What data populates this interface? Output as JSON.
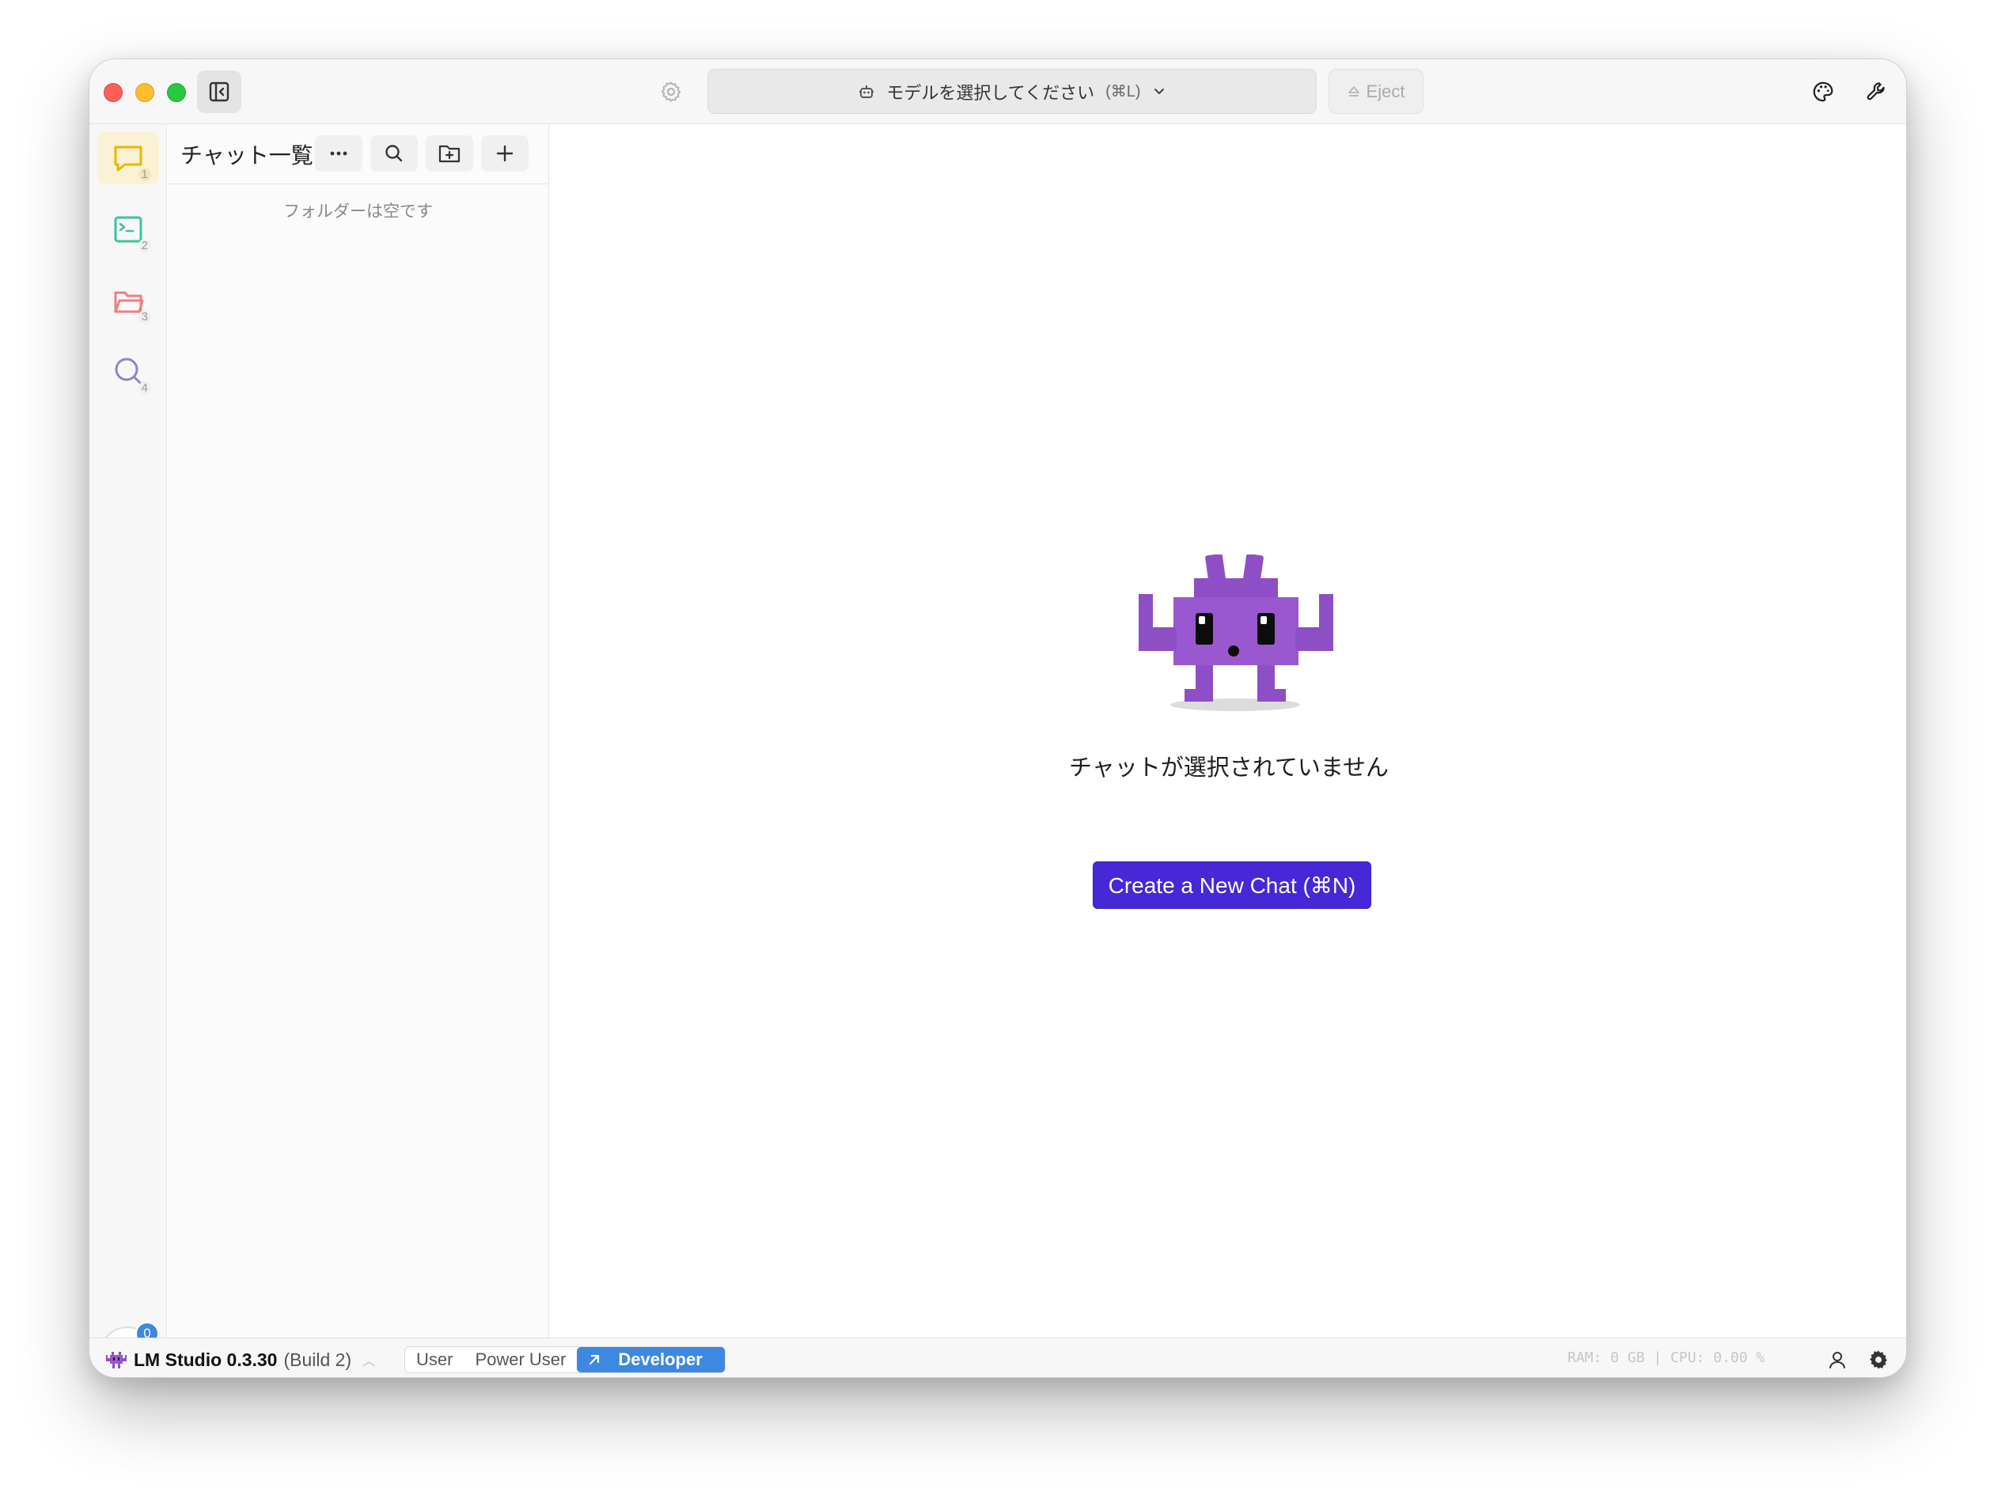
{
  "titlebar": {
    "model_select_label": "モデルを選択してください",
    "model_select_shortcut": "(⌘L)",
    "eject_label": "Eject"
  },
  "rail": {
    "items": [
      {
        "name": "chat",
        "icon": "chat-bubble-icon",
        "number": "1",
        "color": "#e6b800",
        "active": true
      },
      {
        "name": "developer",
        "icon": "terminal-icon",
        "number": "2",
        "color": "#3cc3a0",
        "active": false
      },
      {
        "name": "my-models",
        "icon": "folder-icon",
        "number": "3",
        "color": "#ef7f7f",
        "active": false
      },
      {
        "name": "discover",
        "icon": "search-icon",
        "number": "4",
        "color": "#8f86c9",
        "active": false
      }
    ],
    "download_badge": "0"
  },
  "panel": {
    "title": "チャット一覧",
    "empty_message": "フォルダーは空です"
  },
  "main": {
    "empty_state_text": "チャットが選択されていません",
    "create_button_label": "Create a New Chat (⌘N)"
  },
  "statusbar": {
    "app_name": "LM Studio 0.3.30",
    "build": "(Build 2)",
    "modes": [
      "User",
      "Power User",
      "Developer"
    ],
    "active_mode": "Developer",
    "stats": "RAM: 0 GB  |  CPU: 0.00 %"
  },
  "colors": {
    "accent": "#4628d6",
    "developer_mode": "#3d88e0",
    "mascot": "#8e4fc6"
  }
}
